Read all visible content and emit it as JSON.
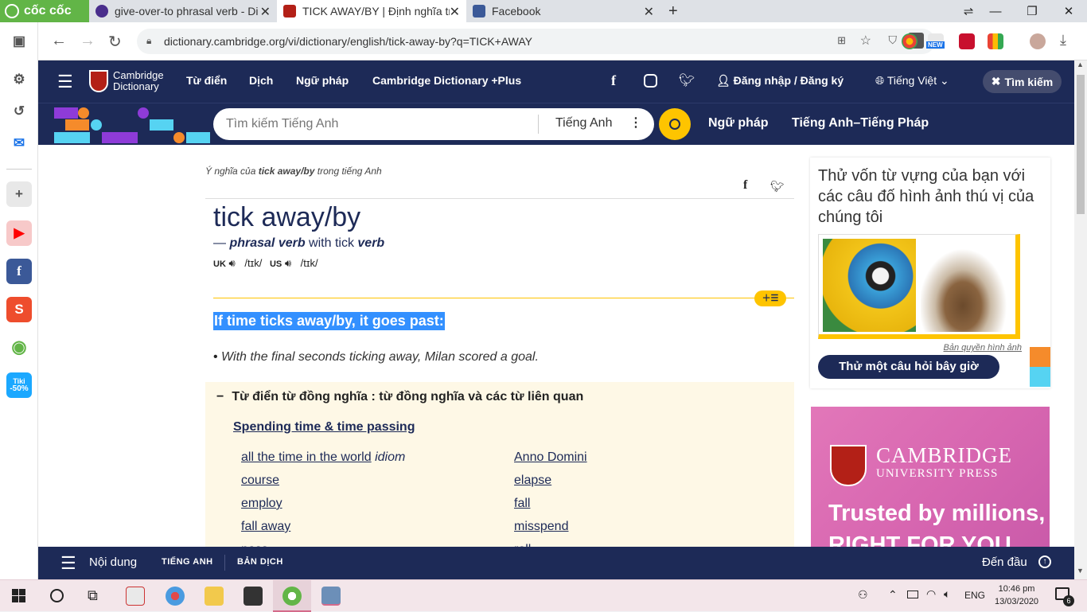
{
  "browser": {
    "brand": "cốc cốc",
    "tabs": [
      {
        "title": "give-over-to phrasal verb - Di",
        "favicon_color": "#4a2e8c"
      },
      {
        "title": "TICK AWAY/BY | Định nghĩa tr",
        "favicon_color": "#b32017"
      },
      {
        "title": "Facebook",
        "favicon_color": "#3b5998"
      }
    ],
    "new_tab": "+",
    "url": "dictionary.cambridge.org/vi/dictionary/english/tick-away-by?q=TICK+AWAY",
    "new_badge": "NEW"
  },
  "sidebar": {
    "items": [
      {
        "name": "gear-icon",
        "glyph": "⚙"
      },
      {
        "name": "history-icon",
        "glyph": "↺"
      },
      {
        "name": "messenger-icon",
        "glyph": "✉",
        "color": "#1a73e8"
      },
      {
        "name": "add-icon",
        "glyph": "+"
      },
      {
        "name": "youtube-icon",
        "glyph": "▶",
        "color": "#ff0000"
      },
      {
        "name": "facebook-icon",
        "glyph": "f",
        "color": "#3b5998"
      },
      {
        "name": "shopee-icon",
        "glyph": "S",
        "color": "#ee4d2d"
      },
      {
        "name": "coccoc-icon",
        "glyph": "◉",
        "color": "#62b547"
      },
      {
        "name": "tiki-icon",
        "glyph": "",
        "color": "#1ba8ff"
      }
    ],
    "tiki_label": "Tiki",
    "tiki_discount": "-50%"
  },
  "cd_nav": {
    "logo_line1": "Cambridge",
    "logo_line2": "Dictionary",
    "links": [
      "Từ điển",
      "Dịch",
      "Ngữ pháp",
      "Cambridge Dictionary +Plus"
    ],
    "login": "Đăng nhập / Đăng ký",
    "language": "Tiếng Việt",
    "search_btn": "Tìm kiếm"
  },
  "cd_search": {
    "placeholder": "Tìm kiếm Tiếng Anh",
    "dict_select": "Tiếng Anh",
    "link1": "Ngữ pháp",
    "link2": "Tiếng Anh–Tiếng Pháp"
  },
  "entry": {
    "breadcrumb_pre": "Ý nghĩa của ",
    "breadcrumb_word": "tick away/by",
    "breadcrumb_post": " trong tiếng Anh",
    "headword": "tick away/by",
    "pos_dash": "— ",
    "pos": "phrasal verb",
    "pos_with": " with tick ",
    "pos_verb": "verb",
    "uk_label": "UK",
    "us_label": "US",
    "uk_ipa": "/tɪk/",
    "us_ipa": "/tɪk/",
    "definition": "If time ticks away/by, it goes past:",
    "example_bullet": "• ",
    "example": "With the final seconds ticking away, Milan scored a goal.",
    "thesaurus_sign": "−",
    "thesaurus_title": "Từ điển từ đồng nghĩa : từ đồng nghĩa và các từ liên quan",
    "thesaurus_category": "Spending time & time passing",
    "left_words": [
      "all the time in the world",
      "course",
      "employ",
      "fall away",
      "pass"
    ],
    "idiom_tag": "idiom",
    "right_words": [
      "Anno Domini",
      "elapse",
      "fall",
      "misspend",
      "roll"
    ]
  },
  "quiz": {
    "title": "Thử vốn từ vựng của bạn với các câu đố hình ảnh thú vị của chúng tôi",
    "credit": "Bản quyền hình ảnh",
    "button": "Thử một câu hỏi bây giờ"
  },
  "ad": {
    "brand1": "CAMBRIDGE",
    "brand2": "UNIVERSITY PRESS",
    "tagline": "Trusted by millions,",
    "tagline2": "RIGHT FOR YOU"
  },
  "bottom_bar": {
    "menu": "Nội dung",
    "tab1": "TIẾNG ANH",
    "tab2": "BẢN DỊCH",
    "top": "Đến đầu"
  },
  "taskbar": {
    "lang": "ENG",
    "time": "10:46 pm",
    "date": "13/03/2020",
    "notif_count": "6"
  }
}
